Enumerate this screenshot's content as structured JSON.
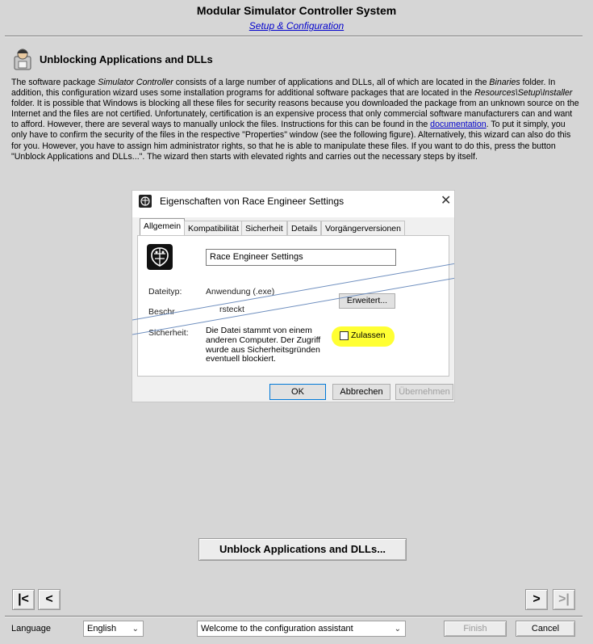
{
  "header": {
    "title": "Modular Simulator Controller System",
    "subtitle": "Setup & Configuration"
  },
  "page": {
    "heading": "Unblocking Applications and DLLs",
    "icon": "wizard-user-icon",
    "description": {
      "p1": "The software package ",
      "p2": "Simulator Controller",
      "p3": " consists of a large number of applications and DLLs, all of which are located in the ",
      "p4": "Binaries",
      "p5": " folder. In addition, this configuration wizard uses some installation programs for additional software packages that are located in the ",
      "p6": "Resources\\Setup\\Installer",
      "p7": " folder. It is possible that Windows is blocking all these files for security reasons because you downloaded the package from an unknown source on the Internet and the files are not certified. Unfortunately, certification is an expensive process that only commercial software manufacturers can and want to afford. However, there are several ways to manually unlock the files. Instructions for this can be found in the ",
      "link": "documentation",
      "p8": ". To put it simply, you only have to confirm the security of the files in the respective \"Properties\" window (see the following figure). Alternatively, this wizard can also do this for you. However, you have to assign him administrator rights, so that he is able to manipulate these files. If you want to do this, press the button \"Unblock Applications and DLLs...\". The wizard then starts with elevated rights and carries out the necessary steps by itself."
    }
  },
  "figure": {
    "window_title": "Eigenschaften von Race Engineer Settings",
    "close": "✕",
    "tabs": [
      "Allgemein",
      "Kompatibilität",
      "Sicherheit",
      "Details",
      "Vorgängerversionen"
    ],
    "name_value": "Race Engineer Settings",
    "type_label": "Dateityp:",
    "type_value": "Anwendung (.exe)",
    "desc_label": "Beschr",
    "desc_value": "rsteckt",
    "advanced_button": "Erweitert...",
    "security_label": "Sicherheit:",
    "security_text": "Die Datei stammt von einem anderen Computer. Der Zugriff wurde aus Sicherheitsgründen eventuell blockiert.",
    "allow_label": "Zulassen",
    "ok": "OK",
    "cancel": "Abbrechen",
    "apply": "Übernehmen",
    "highlight_color": "#ffff33",
    "line_color": "#6f8fbf"
  },
  "actions": {
    "unblock_button": "Unblock Applications and DLLs..."
  },
  "navigation": {
    "first": "|<",
    "prev": "<",
    "next": ">",
    "last": ">|"
  },
  "footer": {
    "language_label": "Language",
    "language_value": "English",
    "step_value": "Welcome to the configuration assistant",
    "finish": "Finish",
    "cancel": "Cancel"
  }
}
